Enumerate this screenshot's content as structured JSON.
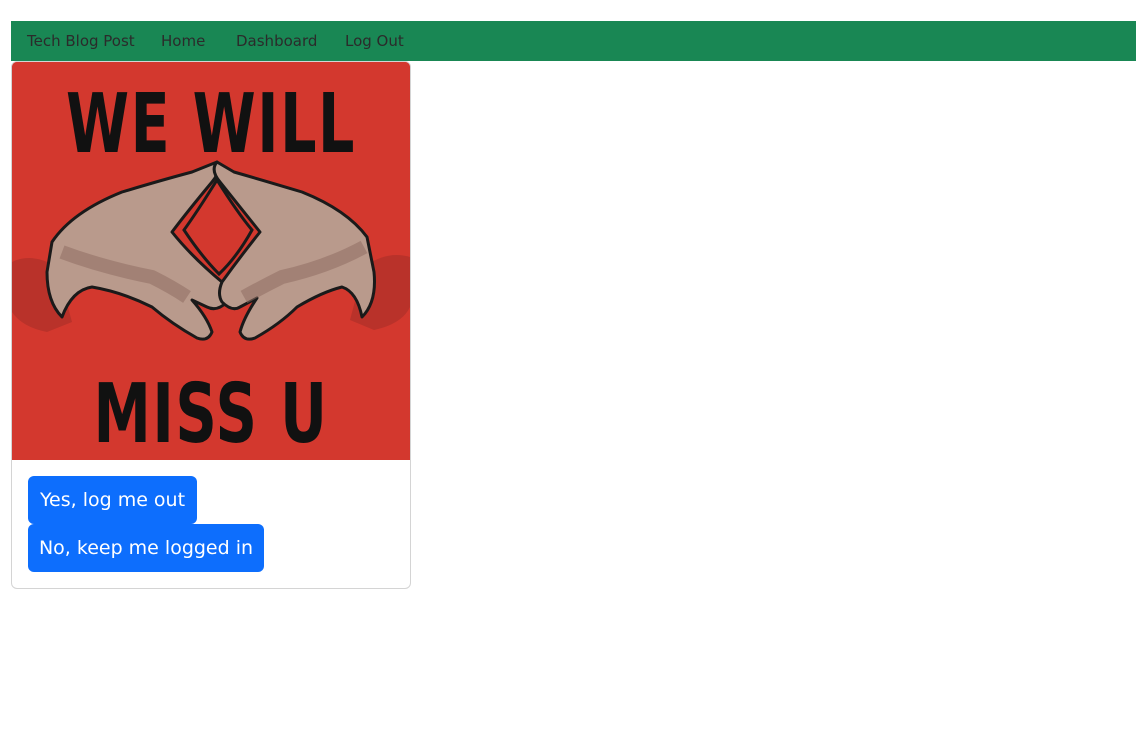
{
  "navbar": {
    "brand": "Tech Blog Post",
    "links": [
      "Home",
      "Dashboard",
      "Log Out"
    ],
    "color": "#198754"
  },
  "card": {
    "image": {
      "line1": "WE WILL",
      "line2": "MISS U",
      "background": "#d3382e",
      "skin": "#b99a8c",
      "shade": "#8f6e62"
    },
    "buttons": {
      "yes_label": "Yes, log me out",
      "no_label": "No, keep me logged in",
      "color": "#0d6efd"
    }
  }
}
